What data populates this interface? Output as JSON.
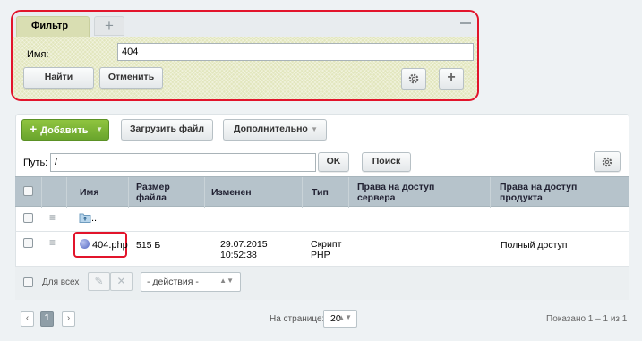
{
  "filter": {
    "tab_label": "Фильтр",
    "add_tab_symbol": "+",
    "name_label": "Имя:",
    "name_value": "404",
    "find_label": "Найти",
    "cancel_label": "Отменить",
    "settings_icon": "gear-icon",
    "add_icon": "plus-icon"
  },
  "toolbar": {
    "add_label": "Добавить",
    "upload_label": "Загрузить файл",
    "more_label": "Дополнительно"
  },
  "path": {
    "label": "Путь:",
    "value": "/",
    "ok_label": "OK",
    "search_label": "Поиск"
  },
  "table": {
    "columns": [
      "Имя",
      "Размер файла",
      "Изменен",
      "Тип",
      "Права на доступ сервера",
      "Права на доступ продукта"
    ],
    "up_row": {
      "name": ".."
    },
    "rows": [
      {
        "name": "404.php",
        "size": "515 Б",
        "modified_date": "29.07.2015",
        "modified_time": "10:52:38",
        "type_line1": "Скрипт",
        "type_line2": "PHP",
        "server_access": "",
        "product_access": "Полный доступ"
      }
    ]
  },
  "footer": {
    "for_all_label": "Для всех",
    "actions_placeholder": "- действия -"
  },
  "pagination": {
    "prev": "‹",
    "current_page": "1",
    "next": "›",
    "per_page_label": "На странице:",
    "per_page_value": "20",
    "shown_text": "Показано 1 – 1 из 1"
  },
  "colors": {
    "accent_green": "#6aa52d",
    "highlight_red": "#e2142b",
    "header_bg": "#b6c3cb"
  }
}
